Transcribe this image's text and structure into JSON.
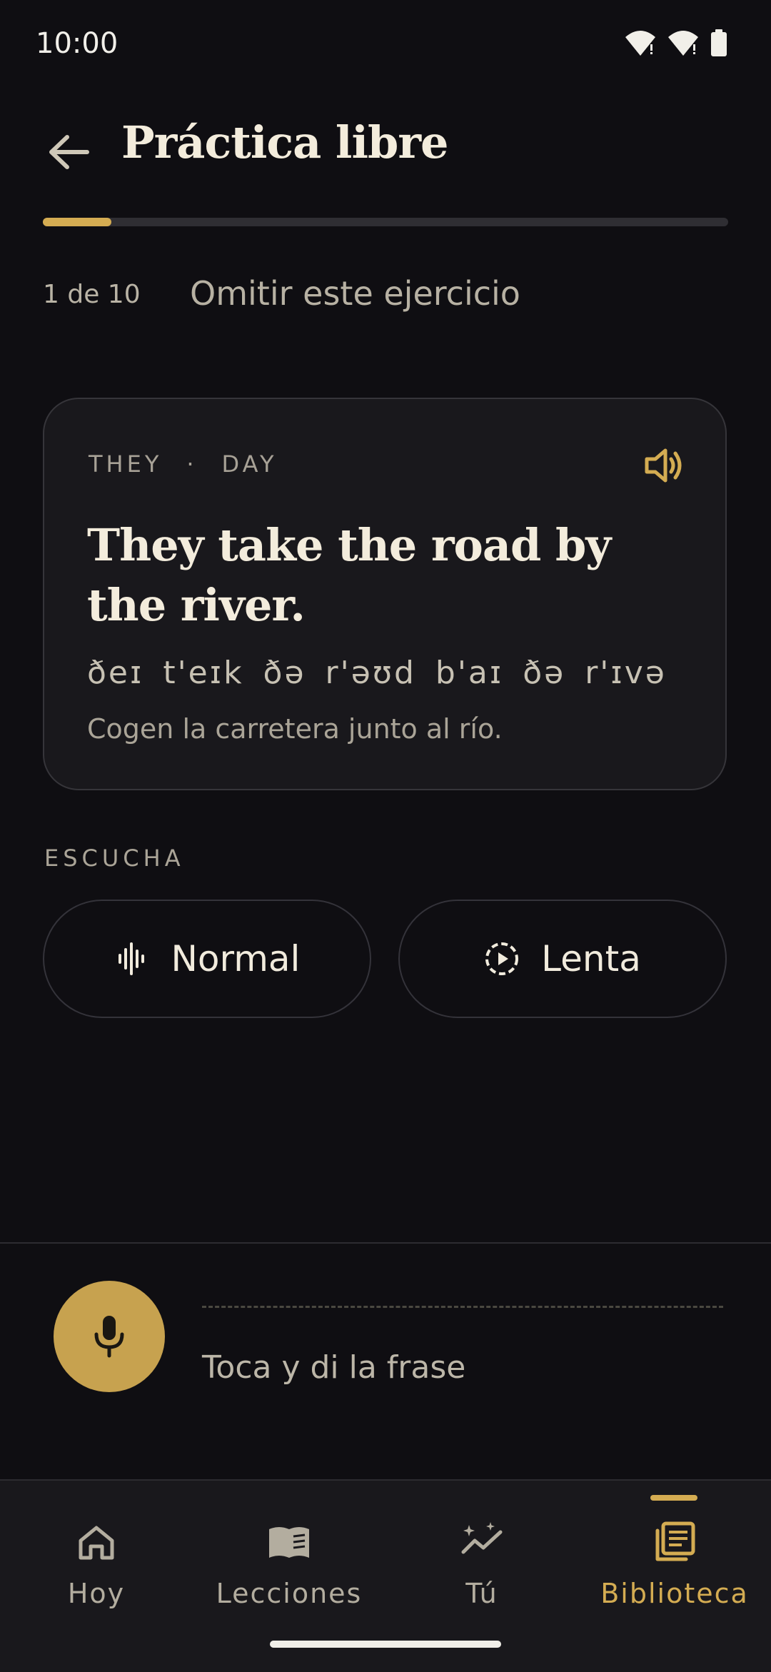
{
  "status": {
    "time": "10:00"
  },
  "header": {
    "title": "Práctica libre"
  },
  "progress": {
    "value": 0.1
  },
  "meta": {
    "counter": "1 de 10",
    "skip_label": "Omitir este ejercicio"
  },
  "card": {
    "syllables": [
      "THEY",
      "·",
      "DAY"
    ],
    "phrase": "They take the road by the river.",
    "ipa": "ðeɪ t'eɪk ðə r'əʊd b'aɪ ðə r'ɪvə",
    "translation": "Cogen la carretera junto al río."
  },
  "listen": {
    "section_label": "ESCUCHA",
    "normal_label": "Normal",
    "slow_label": "Lenta"
  },
  "record": {
    "prompt": "Toca y di la frase"
  },
  "nav": {
    "items": [
      {
        "label": "Hoy",
        "icon": "home-icon"
      },
      {
        "label": "Lecciones",
        "icon": "book-icon"
      },
      {
        "label": "Tú",
        "icon": "sparkle-chart-icon"
      },
      {
        "label": "Biblioteca",
        "icon": "library-icon"
      }
    ],
    "active": "Biblioteca"
  },
  "colors": {
    "accent": "#d4ac52",
    "background": "#0f0e12",
    "card": "#19181c"
  }
}
